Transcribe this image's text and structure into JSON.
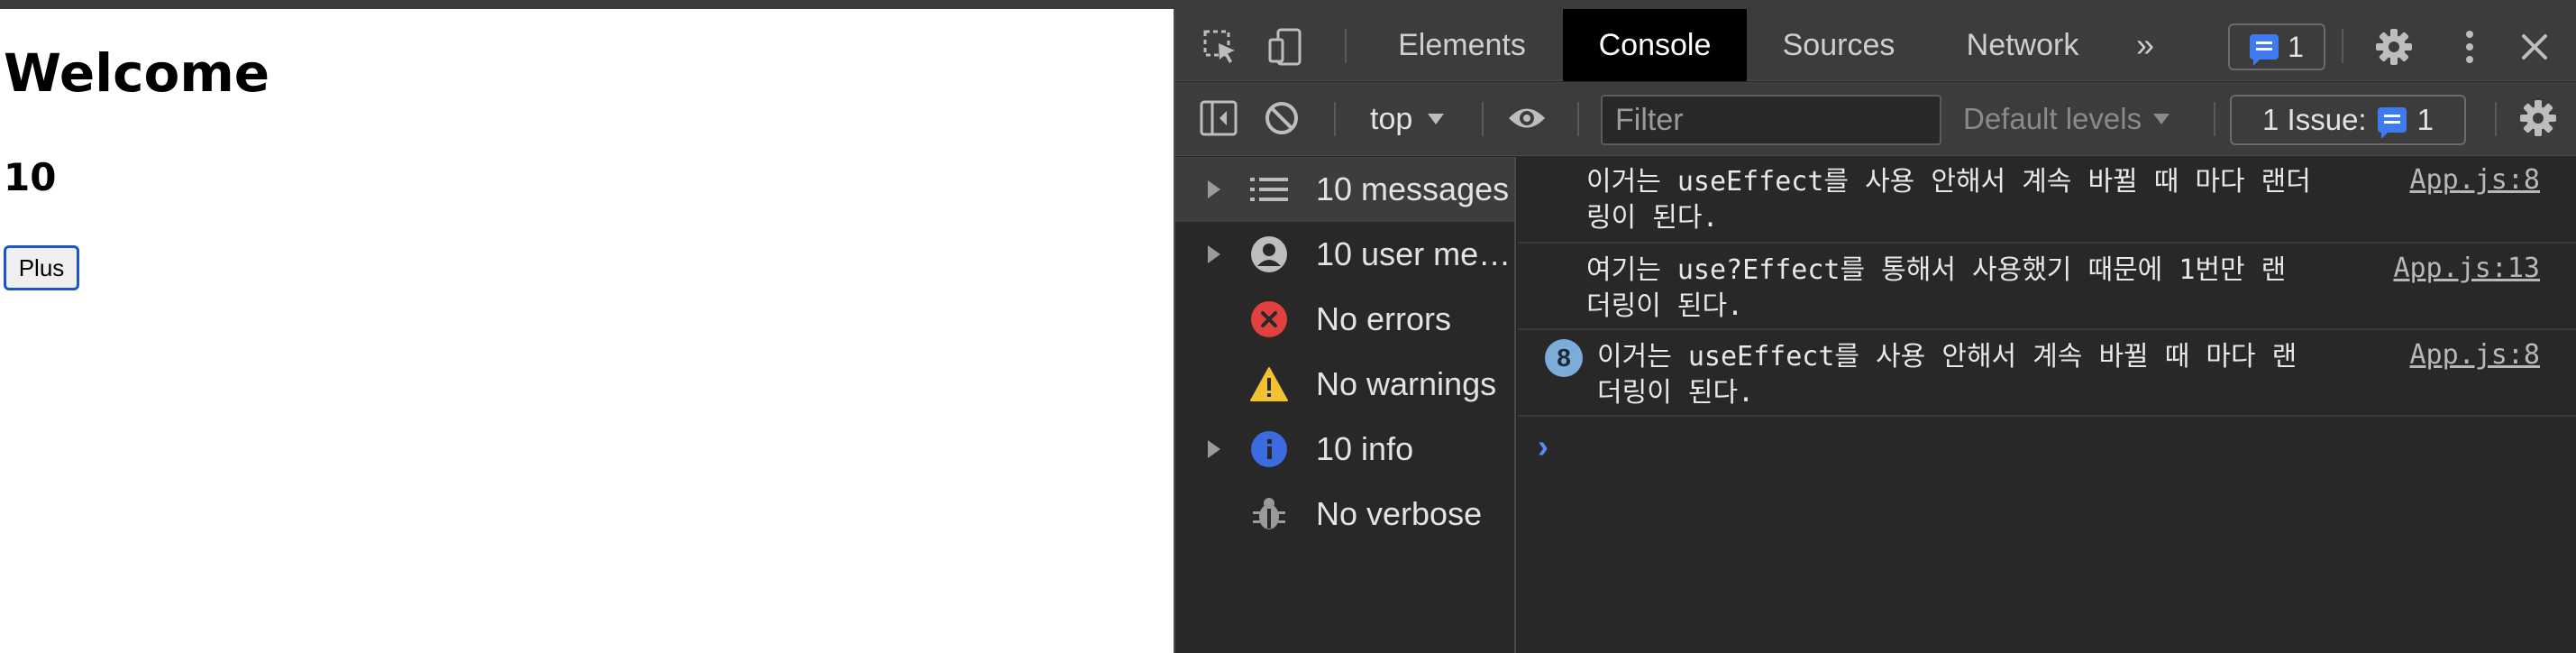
{
  "page": {
    "heading": "Welcome",
    "count": "10",
    "plus_label": "Plus"
  },
  "devtools": {
    "tabs": [
      "Elements",
      "Console",
      "Sources",
      "Network"
    ],
    "active_tab": "Console",
    "more_tabs": "»",
    "issue_count": "1",
    "context": "top",
    "filter_placeholder": "Filter",
    "levels": "Default levels",
    "issues_label": "1 Issue:",
    "issues_count": "1",
    "sidebar": [
      {
        "label": "10 messages",
        "icon": "list-icon",
        "expandable": true
      },
      {
        "label": "10 user me…",
        "icon": "user-icon",
        "expandable": true
      },
      {
        "label": "No errors",
        "icon": "error-icon",
        "expandable": false
      },
      {
        "label": "No warnings",
        "icon": "warning-icon",
        "expandable": false
      },
      {
        "label": "10 info",
        "icon": "info-icon",
        "expandable": true
      },
      {
        "label": "No verbose",
        "icon": "bug-icon",
        "expandable": false
      }
    ],
    "messages": [
      {
        "line1": "이거는 useEffect를 사용 안해서 계속 바뀔 때 마다 랜더",
        "line2": "링이 된다.",
        "source": "App.js:8",
        "count": ""
      },
      {
        "line1": "여기는 use?Effect를 통해서 사용했기 때문에 1번만 랜",
        "line2": "더링이 된다.",
        "source": "App.js:13",
        "count": ""
      },
      {
        "line1": "이거는 useEffect를 사용 안해서 계속 바뀔 때 마다 랜",
        "line2": "더링이 된다.",
        "source": "App.js:8",
        "count": "8"
      }
    ],
    "prompt": "›"
  },
  "colors": {
    "accent_blue": "#3e7bf0",
    "error_red": "#e0413e",
    "warning_yellow": "#f2c233",
    "info_blue": "#3c6be0"
  }
}
